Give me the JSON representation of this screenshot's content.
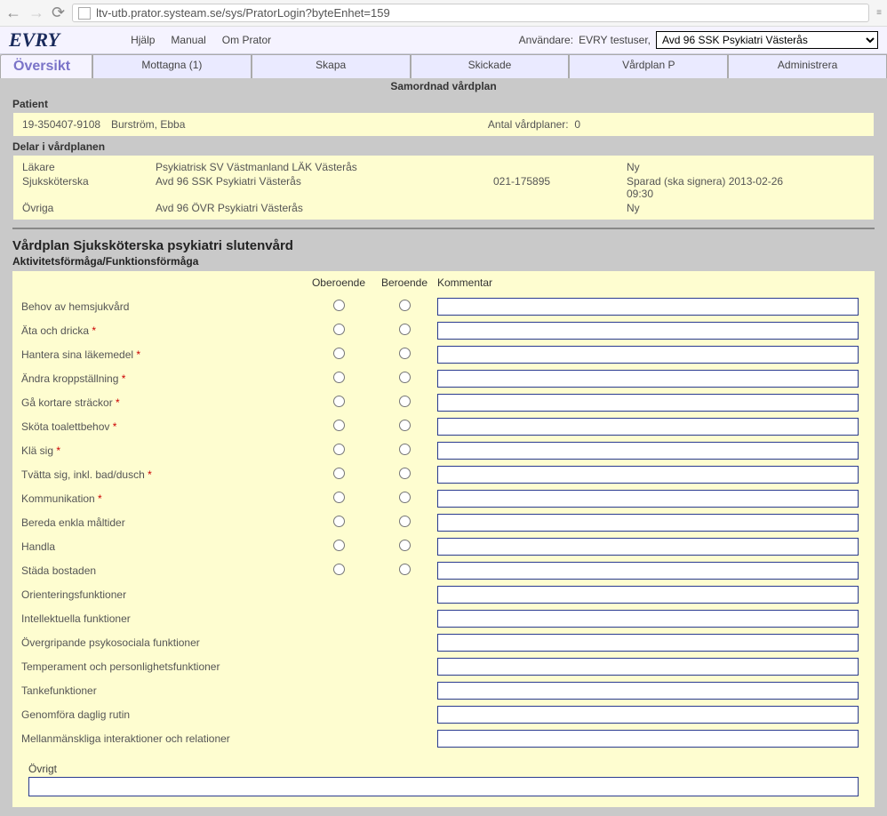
{
  "browser": {
    "url": "ltv-utb.prator.systeam.se/sys/PratorLogin?byteEnhet=159"
  },
  "logo": "EVRY",
  "top_menu": {
    "help": "Hjälp",
    "manual": "Manual",
    "about": "Om Prator"
  },
  "user": {
    "label": "Användare:",
    "name": "EVRY testuser,",
    "unit": "Avd 96 SSK Psykiatri Västerås"
  },
  "tabs": {
    "overview": "Översikt",
    "received": "Mottagna (1)",
    "create": "Skapa",
    "sent": "Skickade",
    "careplan": "Vårdplan P",
    "admin": "Administrera"
  },
  "sub_title": "Samordnad vårdplan",
  "patient": {
    "label": "Patient",
    "id": "19-350407-9108",
    "name": "Burström, Ebba",
    "plans_label": "Antal vårdplaner:",
    "plans_count": "0"
  },
  "parts": {
    "label": "Delar i vårdplanen",
    "rows": [
      {
        "role": "Läkare",
        "unit": "Psykiatrisk SV Västmanland LÄK Västerås",
        "phone": "",
        "status": "Ny",
        "date": ""
      },
      {
        "role": "Sjuksköterska",
        "unit": "Avd 96 SSK Psykiatri Västerås",
        "phone": "021-175895",
        "status": "Sparad (ska signera)",
        "date": "2013-02-26 09:30"
      },
      {
        "role": "Övriga",
        "unit": "Avd 96 ÖVR Psykiatri Västerås",
        "phone": "",
        "status": "Ny",
        "date": ""
      }
    ]
  },
  "form": {
    "title": "Vårdplan Sjuksköterska psykiatri slutenvård",
    "subtitle": "Aktivitetsförmåga/Funktionsförmåga",
    "head": {
      "ob": "Oberoende",
      "be": "Beroende",
      "kom": "Kommentar"
    },
    "rows": [
      {
        "label": "Behov av hemsjukvård",
        "req": false,
        "radios": true
      },
      {
        "label": "Äta och dricka",
        "req": true,
        "radios": true
      },
      {
        "label": "Hantera sina läkemedel",
        "req": true,
        "radios": true
      },
      {
        "label": "Ändra kroppställning",
        "req": true,
        "radios": true
      },
      {
        "label": "Gå kortare sträckor",
        "req": true,
        "radios": true
      },
      {
        "label": "Sköta toalettbehov",
        "req": true,
        "radios": true
      },
      {
        "label": "Klä sig",
        "req": true,
        "radios": true
      },
      {
        "label": "Tvätta sig, inkl. bad/dusch",
        "req": true,
        "radios": true
      },
      {
        "label": "Kommunikation",
        "req": true,
        "radios": true
      },
      {
        "label": "Bereda enkla måltider",
        "req": false,
        "radios": true
      },
      {
        "label": "Handla",
        "req": false,
        "radios": true
      },
      {
        "label": "Städa bostaden",
        "req": false,
        "radios": true
      },
      {
        "label": "Orienteringsfunktioner",
        "req": false,
        "radios": false
      },
      {
        "label": "Intellektuella funktioner",
        "req": false,
        "radios": false
      },
      {
        "label": "Övergripande psykosociala funktioner",
        "req": false,
        "radios": false
      },
      {
        "label": "Temperament och personlighetsfunktioner",
        "req": false,
        "radios": false
      },
      {
        "label": "Tankefunktioner",
        "req": false,
        "radios": false
      },
      {
        "label": "Genomföra daglig rutin",
        "req": false,
        "radios": false
      },
      {
        "label": "Mellanmänskliga interaktioner och relationer",
        "req": false,
        "radios": false
      }
    ],
    "ovrigt": "Övrigt"
  }
}
